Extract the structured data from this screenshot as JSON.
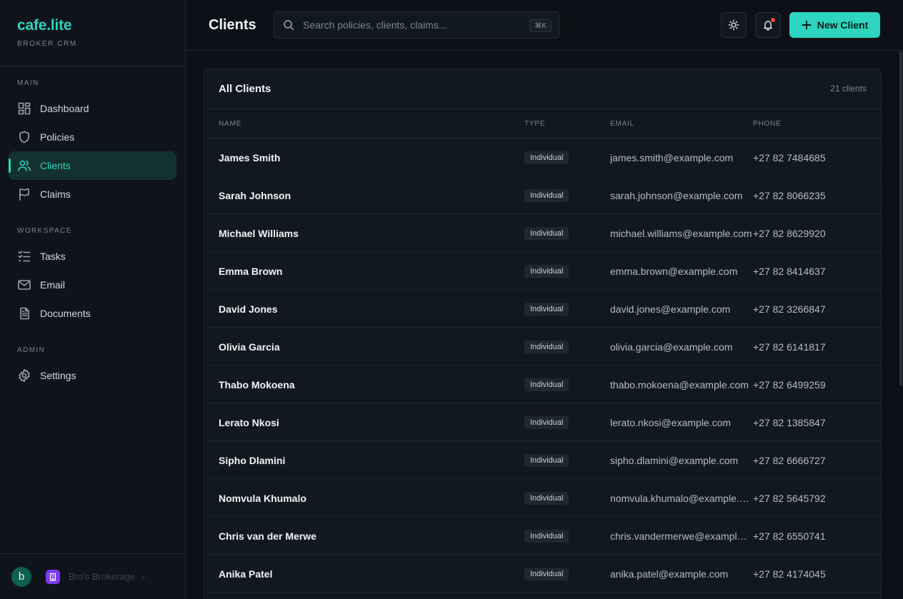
{
  "brand": {
    "name": "cafe.lite",
    "subtitle": "BROKER CRM"
  },
  "nav": {
    "sections": [
      {
        "title": "MAIN",
        "items": [
          {
            "label": "Dashboard",
            "icon": "dashboard-icon",
            "active": false
          },
          {
            "label": "Policies",
            "icon": "shield-icon",
            "active": false
          },
          {
            "label": "Clients",
            "icon": "users-icon",
            "active": true
          },
          {
            "label": "Claims",
            "icon": "flag-icon",
            "active": false
          }
        ]
      },
      {
        "title": "WORKSPACE",
        "items": [
          {
            "label": "Tasks",
            "icon": "tasks-icon",
            "active": false
          },
          {
            "label": "Email",
            "icon": "mail-icon",
            "active": false
          },
          {
            "label": "Documents",
            "icon": "document-icon",
            "active": false
          }
        ]
      },
      {
        "title": "ADMIN",
        "items": [
          {
            "label": "Settings",
            "icon": "gear-icon",
            "active": false
          }
        ]
      }
    ]
  },
  "footer": {
    "avatar_initial": "b",
    "org_name": "Bro's Brokerage",
    "org_icon": "building-icon"
  },
  "header": {
    "title": "Clients",
    "search_placeholder": "Search policies, clients, claims...",
    "search_shortcut": "⌘K",
    "new_button_label": "New Client"
  },
  "colors": {
    "accent": "#2dd4bf",
    "notification": "#ef4444",
    "org": "#7c3aed"
  },
  "table": {
    "title": "All Clients",
    "count": "21 clients",
    "columns": [
      "NAME",
      "TYPE",
      "EMAIL",
      "PHONE"
    ],
    "rows": [
      {
        "name": "James Smith",
        "type": "Individual",
        "email": "james.smith@example.com",
        "phone": "+27 82 7484685"
      },
      {
        "name": "Sarah Johnson",
        "type": "Individual",
        "email": "sarah.johnson@example.com",
        "phone": "+27 82 8066235"
      },
      {
        "name": "Michael Williams",
        "type": "Individual",
        "email": "michael.williams@example.com",
        "phone": "+27 82 8629920"
      },
      {
        "name": "Emma Brown",
        "type": "Individual",
        "email": "emma.brown@example.com",
        "phone": "+27 82 8414637"
      },
      {
        "name": "David Jones",
        "type": "Individual",
        "email": "david.jones@example.com",
        "phone": "+27 82 3266847"
      },
      {
        "name": "Olivia Garcia",
        "type": "Individual",
        "email": "olivia.garcia@example.com",
        "phone": "+27 82 6141817"
      },
      {
        "name": "Thabo Mokoena",
        "type": "Individual",
        "email": "thabo.mokoena@example.com",
        "phone": "+27 82 6499259"
      },
      {
        "name": "Lerato Nkosi",
        "type": "Individual",
        "email": "lerato.nkosi@example.com",
        "phone": "+27 82 1385847"
      },
      {
        "name": "Sipho Dlamini",
        "type": "Individual",
        "email": "sipho.dlamini@example.com",
        "phone": "+27 82 6666727"
      },
      {
        "name": "Nomvula Khumalo",
        "type": "Individual",
        "email": "nomvula.khumalo@example.com",
        "phone": "+27 82 5645792"
      },
      {
        "name": "Chris van der Merwe",
        "type": "Individual",
        "email": "chris.vandermerwe@example.com",
        "phone": "+27 82 6550741"
      },
      {
        "name": "Anika Patel",
        "type": "Individual",
        "email": "anika.patel@example.com",
        "phone": "+27 82 4174045"
      }
    ]
  }
}
